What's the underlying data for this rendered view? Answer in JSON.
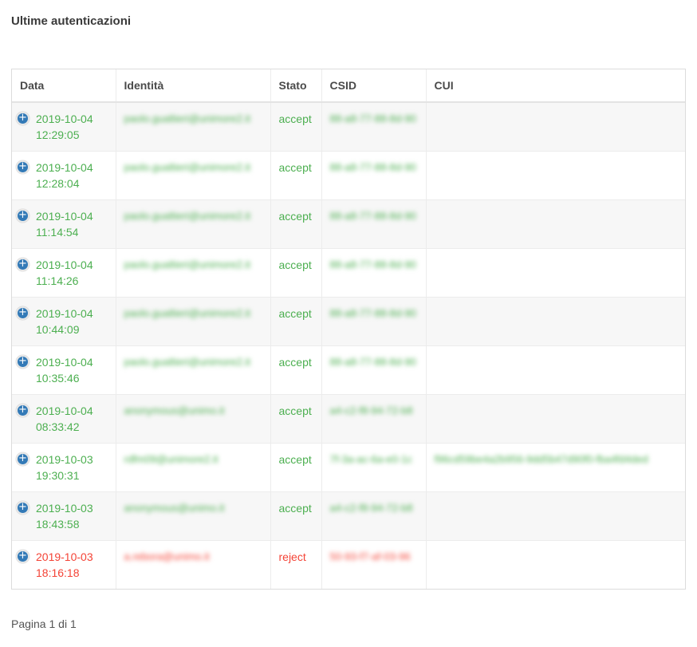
{
  "page": {
    "title": "Ultime autenticazioni"
  },
  "table": {
    "headers": [
      "Data",
      "Identità",
      "Stato",
      "CSID",
      "CUI"
    ],
    "rows": [
      {
        "date": "2019-10-04",
        "time": "12:29:05",
        "identity": "paolo.gualtieri@unimore2.it",
        "status": "accept",
        "csid": "88-a8-77-88-8d-90",
        "cui": ""
      },
      {
        "date": "2019-10-04",
        "time": "12:28:04",
        "identity": "paolo.gualtieri@unimore2.it",
        "status": "accept",
        "csid": "88-a8-77-88-8d-90",
        "cui": ""
      },
      {
        "date": "2019-10-04",
        "time": "11:14:54",
        "identity": "paolo.gualtieri@unimore2.it",
        "status": "accept",
        "csid": "88-a8-77-88-8d-90",
        "cui": ""
      },
      {
        "date": "2019-10-04",
        "time": "11:14:26",
        "identity": "paolo.gualtieri@unimore2.it",
        "status": "accept",
        "csid": "88-a8-77-88-8d-90",
        "cui": ""
      },
      {
        "date": "2019-10-04",
        "time": "10:44:09",
        "identity": "paolo.gualtieri@unimore2.it",
        "status": "accept",
        "csid": "88-a8-77-88-8d-90",
        "cui": ""
      },
      {
        "date": "2019-10-04",
        "time": "10:35:46",
        "identity": "paolo.gualtieri@unimore2.it",
        "status": "accept",
        "csid": "88-a8-77-88-8d-90",
        "cui": ""
      },
      {
        "date": "2019-10-04",
        "time": "08:33:42",
        "identity": "anonymous@unimo.it",
        "status": "accept",
        "csid": "a4-c2-f8-94-72-b8",
        "cui": ""
      },
      {
        "date": "2019-10-03",
        "time": "19:30:31",
        "identity": "rdfm09@unimore2.it",
        "status": "accept",
        "csid": "7f-3a-ac-6a-e0-1c",
        "cui": "f96cd59be4a2b956-9dd5b47d90f0-fba4fd4ded"
      },
      {
        "date": "2019-10-03",
        "time": "18:43:58",
        "identity": "anonymous@unimo.it",
        "status": "accept",
        "csid": "a4-c2-f8-94-72-b8",
        "cui": ""
      },
      {
        "date": "2019-10-03",
        "time": "18:16:18",
        "identity": "a.rebora@unimo.it",
        "status": "reject",
        "csid": "50-93-f7-af-03-96",
        "cui": ""
      }
    ]
  },
  "pagination": {
    "label": "Pagina 1 di 1"
  },
  "colors": {
    "accept": "#4caf50",
    "reject": "#f44336",
    "expand_button": "#337ab7"
  },
  "icons": {
    "expand": "plus-circle-icon"
  }
}
